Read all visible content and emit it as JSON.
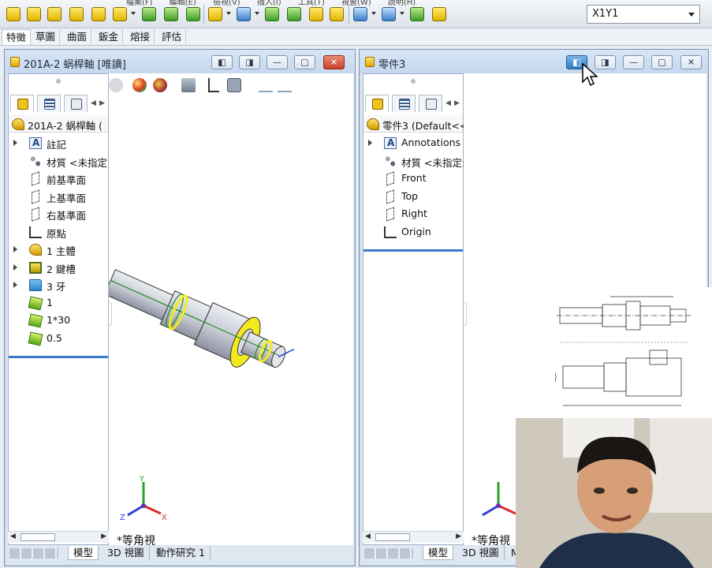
{
  "toolbar": {
    "menu_fragments": [
      "檔案(F)",
      "編輯(E)",
      "檢視(V)",
      "插入(I)",
      "工具(T)",
      "視窗(W)",
      "說明(H)"
    ],
    "configuration_value": "X1Y1"
  },
  "command_tabs": [
    "特徵",
    "草圖",
    "曲面",
    "鈑金",
    "熔接",
    "評估"
  ],
  "left_window": {
    "title": "201A-2 蜗桿軸 [唯讀]",
    "tree_root": "201A-2 蜗桿軸 (",
    "items": [
      {
        "label": "註記",
        "icon": "annotations-icon",
        "expandable": true
      },
      {
        "label": "材質 <未指定",
        "icon": "material-icon",
        "expandable": false
      },
      {
        "label": "前基準面",
        "icon": "plane-icon",
        "expandable": false
      },
      {
        "label": "上基準面",
        "icon": "plane-icon",
        "expandable": false
      },
      {
        "label": "右基準面",
        "icon": "plane-icon",
        "expandable": false
      },
      {
        "label": "原點",
        "icon": "origin-icon",
        "expandable": false
      },
      {
        "label": "1 主體",
        "icon": "revolve-icon",
        "expandable": true
      },
      {
        "label": "2 鍵槽",
        "icon": "keyway-icon",
        "expandable": true
      },
      {
        "label": "3 牙",
        "icon": "folder-icon",
        "expandable": true
      },
      {
        "label": "1",
        "icon": "config-icon",
        "expandable": false
      },
      {
        "label": "1*30",
        "icon": "config-icon",
        "expandable": false
      },
      {
        "label": "0.5",
        "icon": "config-icon",
        "expandable": false
      }
    ],
    "view_name": "*等角視",
    "bottom_tabs": [
      "模型",
      "3D 視圖",
      "動作研究 1"
    ]
  },
  "right_window": {
    "title": "零件3",
    "tree_root": "零件3  (Default<<",
    "items": [
      {
        "label": "Annotations",
        "icon": "annotations-icon",
        "expandable": true
      },
      {
        "label": "材質 <未指定:",
        "icon": "material-icon",
        "expandable": false
      },
      {
        "label": "Front",
        "icon": "plane-icon",
        "expandable": false
      },
      {
        "label": "Top",
        "icon": "plane-icon",
        "expandable": false
      },
      {
        "label": "Right",
        "icon": "plane-icon",
        "expandable": false
      },
      {
        "label": "Origin",
        "icon": "origin-icon",
        "expandable": false
      }
    ],
    "view_name": "*等角視",
    "bottom_tabs": [
      "模型",
      "3D 視圖",
      "M"
    ]
  },
  "triad_labels": {
    "x": "X",
    "y": "Y",
    "z": "Z"
  },
  "colors": {
    "accent": "#3a7bc8",
    "close_button": "#c9402a",
    "part_gray": "#c9ccd6",
    "face_highlight": "#f2ea1e",
    "edge_green": "#1f8a1f"
  }
}
